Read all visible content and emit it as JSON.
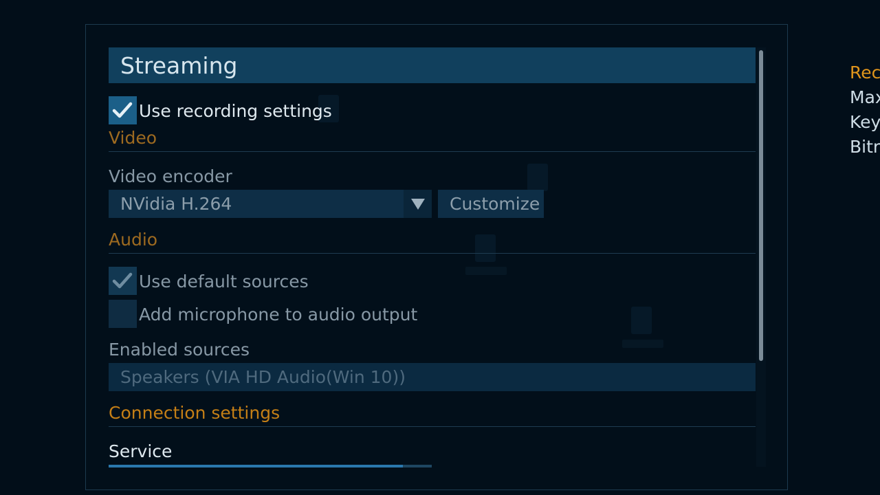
{
  "panel": {
    "title": "Streaming",
    "use_recording_settings": {
      "label": "Use recording settings",
      "checked": true
    },
    "video": {
      "section_label": "Video",
      "encoder_label": "Video encoder",
      "encoder_value": "NVidia H.264",
      "customize_label": "Customize"
    },
    "audio": {
      "section_label": "Audio",
      "use_default_sources": {
        "label": "Use default sources",
        "checked": true
      },
      "add_microphone": {
        "label": "Add microphone to audio output",
        "checked": false
      },
      "enabled_sources_label": "Enabled sources",
      "enabled_sources_value": "Speakers (VIA HD Audio(Win 10))"
    },
    "connection": {
      "section_label": "Connection settings",
      "service_label": "Service",
      "service_progress": 0.91
    }
  },
  "side_menu": {
    "items": [
      {
        "label": "Rec",
        "color": "#e0951c"
      },
      {
        "label": "Max",
        "color": "#cfdde6"
      },
      {
        "label": "Key",
        "color": "#cfdde6"
      },
      {
        "label": "Bitra",
        "color": "#cfdde6"
      }
    ]
  },
  "colors": {
    "header_bg": "#11405d",
    "accent_orange": "#c57f16",
    "checkbox_on": "#1b5f88"
  }
}
